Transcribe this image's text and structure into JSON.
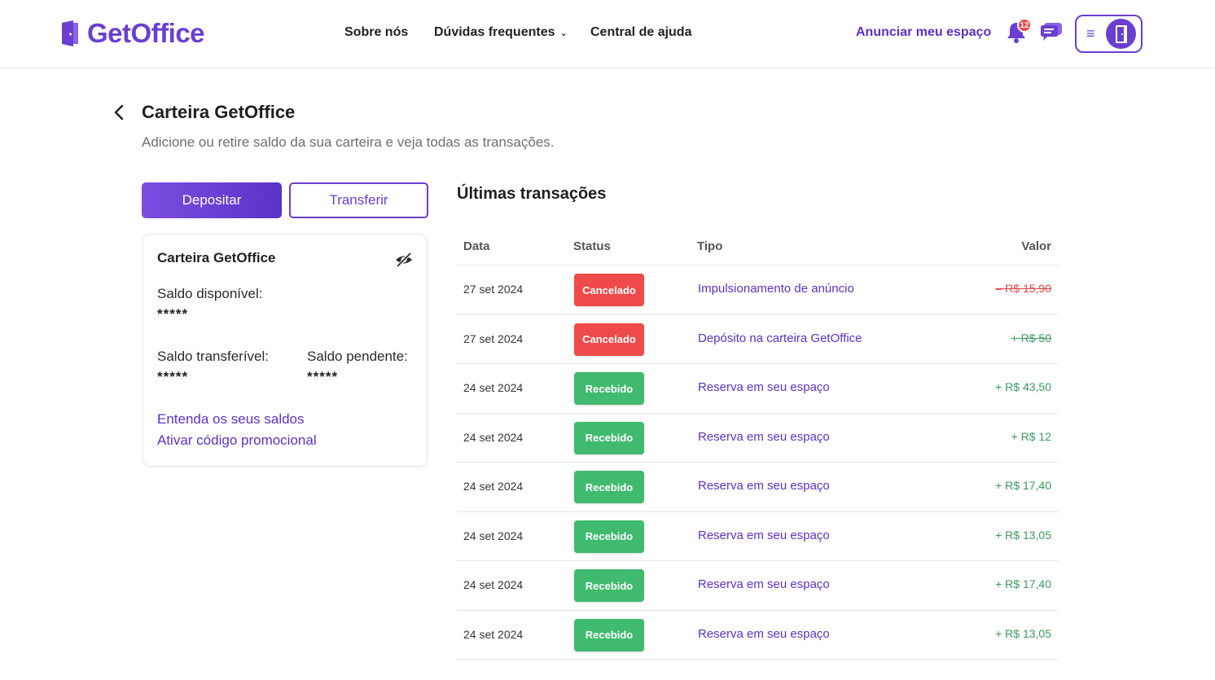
{
  "header": {
    "logo_text": "GetOffice",
    "nav": [
      {
        "label": "Sobre nós"
      },
      {
        "label": "Dúvidas frequentes"
      },
      {
        "label": "Central de ajuda"
      }
    ],
    "announce_label": "Anunciar meu espaço",
    "notification_count": "12",
    "icons": [
      "door-logo-icon",
      "bell-icon",
      "chat-icon",
      "menu-icon",
      "avatar-door-icon"
    ]
  },
  "page": {
    "title": "Carteira GetOffice",
    "subtitle": "Adicione ou retire saldo da sua carteira e veja todas as transações.",
    "deposit_label": "Depositar",
    "transfer_label": "Transferir"
  },
  "wallet": {
    "title": "Carteira GetOffice",
    "available_label": "Saldo disponível:",
    "available_value": "*****",
    "transferable_label": "Saldo transferível:",
    "transferable_value": "*****",
    "pending_label": "Saldo pendente:",
    "pending_value": "*****",
    "link_understand": "Entenda os seus saldos",
    "link_promo": "Ativar código promocional"
  },
  "transactions": {
    "title": "Últimas transações",
    "headers": {
      "date": "Data",
      "status": "Status",
      "type": "Tipo",
      "value": "Valor"
    },
    "rows": [
      {
        "date": "27 set 2024",
        "status": "Cancelado",
        "type": "Impulsionamento de anúncio",
        "value": "– R$ 15,90"
      },
      {
        "date": "27 set 2024",
        "status": "Cancelado",
        "type": "Depósito na carteira GetOffice",
        "value": "+ R$ 50"
      },
      {
        "date": "24 set 2024",
        "status": "Recebido",
        "type": "Reserva em seu espaço",
        "value": "+ R$ 43,50"
      },
      {
        "date": "24 set 2024",
        "status": "Recebido",
        "type": "Reserva em seu espaço",
        "value": "+ R$ 12"
      },
      {
        "date": "24 set 2024",
        "status": "Recebido",
        "type": "Reserva em seu espaço",
        "value": "+ R$ 17,40"
      },
      {
        "date": "24 set 2024",
        "status": "Recebido",
        "type": "Reserva em seu espaço",
        "value": "+ R$ 13,05"
      },
      {
        "date": "24 set 2024",
        "status": "Recebido",
        "type": "Reserva em seu espaço",
        "value": "+ R$ 17,40"
      },
      {
        "date": "24 set 2024",
        "status": "Recebido",
        "type": "Reserva em seu espaço",
        "value": "+ R$ 13,05"
      }
    ]
  },
  "colors": {
    "brand": "#6a3fd0",
    "cancel": "#ef4a4a",
    "received": "#3fba6e",
    "negative_text": "#e04848",
    "positive_text": "#3a9a5e"
  }
}
